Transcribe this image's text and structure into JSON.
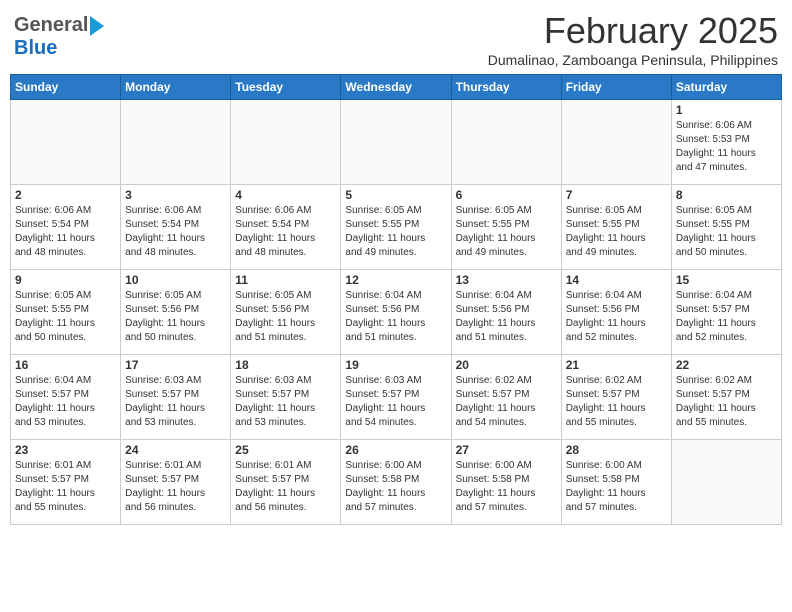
{
  "header": {
    "logo_general": "General",
    "logo_blue": "Blue",
    "month_year": "February 2025",
    "location": "Dumalinao, Zamboanga Peninsula, Philippines"
  },
  "weekdays": [
    "Sunday",
    "Monday",
    "Tuesday",
    "Wednesday",
    "Thursday",
    "Friday",
    "Saturday"
  ],
  "weeks": [
    [
      {
        "day": "",
        "info": ""
      },
      {
        "day": "",
        "info": ""
      },
      {
        "day": "",
        "info": ""
      },
      {
        "day": "",
        "info": ""
      },
      {
        "day": "",
        "info": ""
      },
      {
        "day": "",
        "info": ""
      },
      {
        "day": "1",
        "info": "Sunrise: 6:06 AM\nSunset: 5:53 PM\nDaylight: 11 hours\nand 47 minutes."
      }
    ],
    [
      {
        "day": "2",
        "info": "Sunrise: 6:06 AM\nSunset: 5:54 PM\nDaylight: 11 hours\nand 48 minutes."
      },
      {
        "day": "3",
        "info": "Sunrise: 6:06 AM\nSunset: 5:54 PM\nDaylight: 11 hours\nand 48 minutes."
      },
      {
        "day": "4",
        "info": "Sunrise: 6:06 AM\nSunset: 5:54 PM\nDaylight: 11 hours\nand 48 minutes."
      },
      {
        "day": "5",
        "info": "Sunrise: 6:05 AM\nSunset: 5:55 PM\nDaylight: 11 hours\nand 49 minutes."
      },
      {
        "day": "6",
        "info": "Sunrise: 6:05 AM\nSunset: 5:55 PM\nDaylight: 11 hours\nand 49 minutes."
      },
      {
        "day": "7",
        "info": "Sunrise: 6:05 AM\nSunset: 5:55 PM\nDaylight: 11 hours\nand 49 minutes."
      },
      {
        "day": "8",
        "info": "Sunrise: 6:05 AM\nSunset: 5:55 PM\nDaylight: 11 hours\nand 50 minutes."
      }
    ],
    [
      {
        "day": "9",
        "info": "Sunrise: 6:05 AM\nSunset: 5:55 PM\nDaylight: 11 hours\nand 50 minutes."
      },
      {
        "day": "10",
        "info": "Sunrise: 6:05 AM\nSunset: 5:56 PM\nDaylight: 11 hours\nand 50 minutes."
      },
      {
        "day": "11",
        "info": "Sunrise: 6:05 AM\nSunset: 5:56 PM\nDaylight: 11 hours\nand 51 minutes."
      },
      {
        "day": "12",
        "info": "Sunrise: 6:04 AM\nSunset: 5:56 PM\nDaylight: 11 hours\nand 51 minutes."
      },
      {
        "day": "13",
        "info": "Sunrise: 6:04 AM\nSunset: 5:56 PM\nDaylight: 11 hours\nand 51 minutes."
      },
      {
        "day": "14",
        "info": "Sunrise: 6:04 AM\nSunset: 5:56 PM\nDaylight: 11 hours\nand 52 minutes."
      },
      {
        "day": "15",
        "info": "Sunrise: 6:04 AM\nSunset: 5:57 PM\nDaylight: 11 hours\nand 52 minutes."
      }
    ],
    [
      {
        "day": "16",
        "info": "Sunrise: 6:04 AM\nSunset: 5:57 PM\nDaylight: 11 hours\nand 53 minutes."
      },
      {
        "day": "17",
        "info": "Sunrise: 6:03 AM\nSunset: 5:57 PM\nDaylight: 11 hours\nand 53 minutes."
      },
      {
        "day": "18",
        "info": "Sunrise: 6:03 AM\nSunset: 5:57 PM\nDaylight: 11 hours\nand 53 minutes."
      },
      {
        "day": "19",
        "info": "Sunrise: 6:03 AM\nSunset: 5:57 PM\nDaylight: 11 hours\nand 54 minutes."
      },
      {
        "day": "20",
        "info": "Sunrise: 6:02 AM\nSunset: 5:57 PM\nDaylight: 11 hours\nand 54 minutes."
      },
      {
        "day": "21",
        "info": "Sunrise: 6:02 AM\nSunset: 5:57 PM\nDaylight: 11 hours\nand 55 minutes."
      },
      {
        "day": "22",
        "info": "Sunrise: 6:02 AM\nSunset: 5:57 PM\nDaylight: 11 hours\nand 55 minutes."
      }
    ],
    [
      {
        "day": "23",
        "info": "Sunrise: 6:01 AM\nSunset: 5:57 PM\nDaylight: 11 hours\nand 55 minutes."
      },
      {
        "day": "24",
        "info": "Sunrise: 6:01 AM\nSunset: 5:57 PM\nDaylight: 11 hours\nand 56 minutes."
      },
      {
        "day": "25",
        "info": "Sunrise: 6:01 AM\nSunset: 5:57 PM\nDaylight: 11 hours\nand 56 minutes."
      },
      {
        "day": "26",
        "info": "Sunrise: 6:00 AM\nSunset: 5:58 PM\nDaylight: 11 hours\nand 57 minutes."
      },
      {
        "day": "27",
        "info": "Sunrise: 6:00 AM\nSunset: 5:58 PM\nDaylight: 11 hours\nand 57 minutes."
      },
      {
        "day": "28",
        "info": "Sunrise: 6:00 AM\nSunset: 5:58 PM\nDaylight: 11 hours\nand 57 minutes."
      },
      {
        "day": "",
        "info": ""
      }
    ]
  ]
}
